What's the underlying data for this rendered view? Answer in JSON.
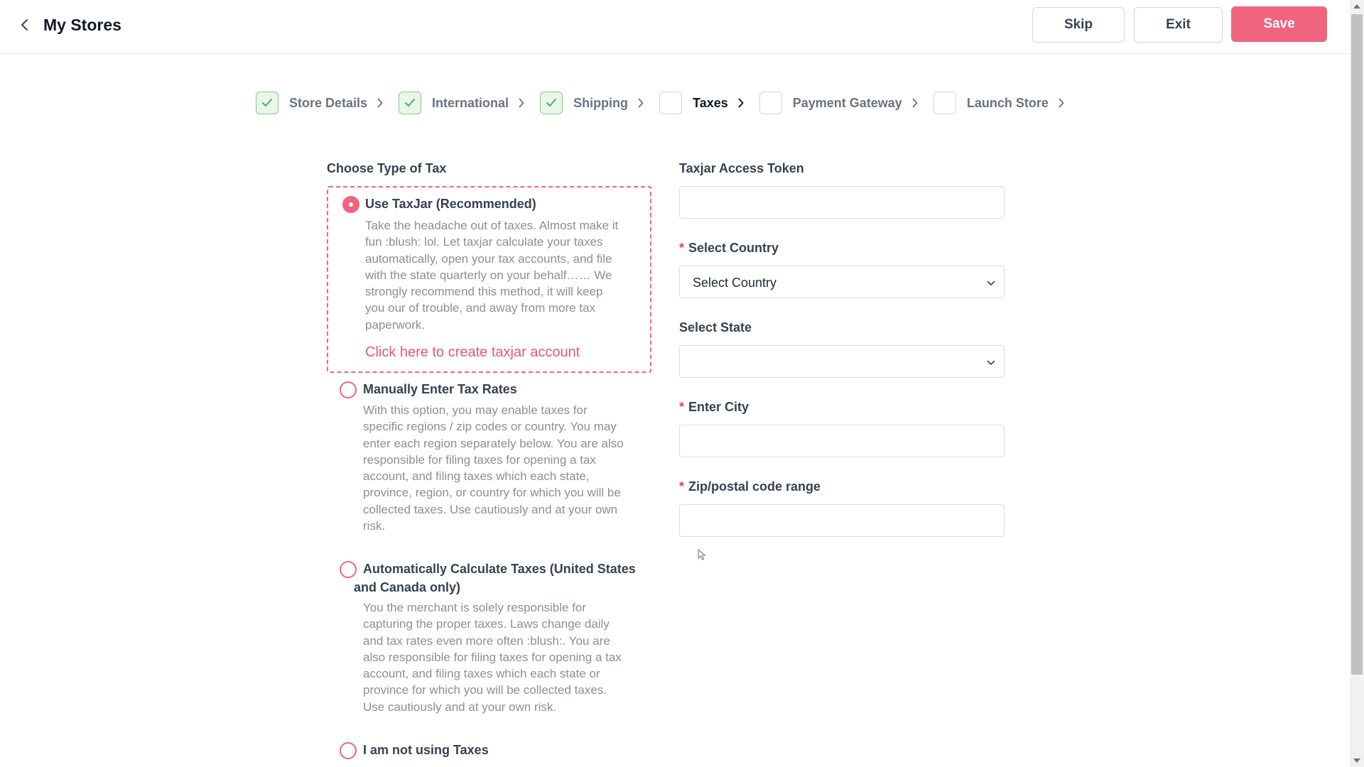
{
  "header": {
    "title": "My Stores",
    "skip_label": "Skip",
    "exit_label": "Exit",
    "save_label": "Save"
  },
  "stepper": {
    "steps": [
      {
        "label": "Store Details",
        "status": "done"
      },
      {
        "label": "International",
        "status": "done"
      },
      {
        "label": "Shipping",
        "status": "done"
      },
      {
        "label": "Taxes",
        "status": "active"
      },
      {
        "label": "Payment Gateway",
        "status": "pending"
      },
      {
        "label": "Launch Store",
        "status": "pending"
      }
    ]
  },
  "tax_type": {
    "heading": "Choose Type of Tax",
    "options": [
      {
        "title": "Use TaxJar (Recommended)",
        "desc_lines": [
          "Take the headache out of taxes. Almost make it",
          "fun :blush: lol. Let taxjar calculate your taxes",
          "automatically, open your tax accounts, and file",
          "with the state quarterly on your behalf…… We",
          "strongly recommend this method, it will keep",
          "you our of trouble, and away from more tax",
          "paperwork."
        ],
        "link": "Click here to create taxjar account",
        "selected": true
      },
      {
        "title": "Manually Enter Tax Rates",
        "desc_lines": [
          "With this option, you may enable taxes for",
          "specific regions / zip codes or country. You may",
          "enter each region separately below. You are also",
          "responsible for filing taxes for opening a tax",
          "account, and filing taxes which each state,",
          "province, region, or country for which you will be",
          "collected taxes. Use cautiously and at your own",
          "risk."
        ],
        "selected": false
      },
      {
        "title_lines": [
          "Automatically Calculate Taxes (United States",
          "and Canada only)"
        ],
        "desc_lines": [
          "You the merchant is solely responsible for",
          "capturing the proper taxes. Laws change daily",
          "and tax rates even more often :blush:. You are",
          "also responsible for filing taxes for opening a tax",
          "account, and filing taxes which each state or",
          "province for which you will be collected taxes.",
          "Use cautiously and at your own risk."
        ],
        "selected": false
      },
      {
        "title": "I am not using Taxes",
        "selected": false
      }
    ]
  },
  "form": {
    "taxjar_token_label": "Taxjar Access Token",
    "taxjar_token_value": "",
    "country_label": "Select Country",
    "country_value": "Select Country",
    "state_label": "Select State",
    "state_value": "",
    "city_label": "Enter City",
    "city_value": "",
    "zip_label": "Zip/postal code range",
    "zip_value": "",
    "required_mark": "*"
  },
  "colors": {
    "accent": "#f0647e",
    "link": "#e8577a",
    "done_bg": "#e8f7e8",
    "done_check": "#4caf50"
  }
}
